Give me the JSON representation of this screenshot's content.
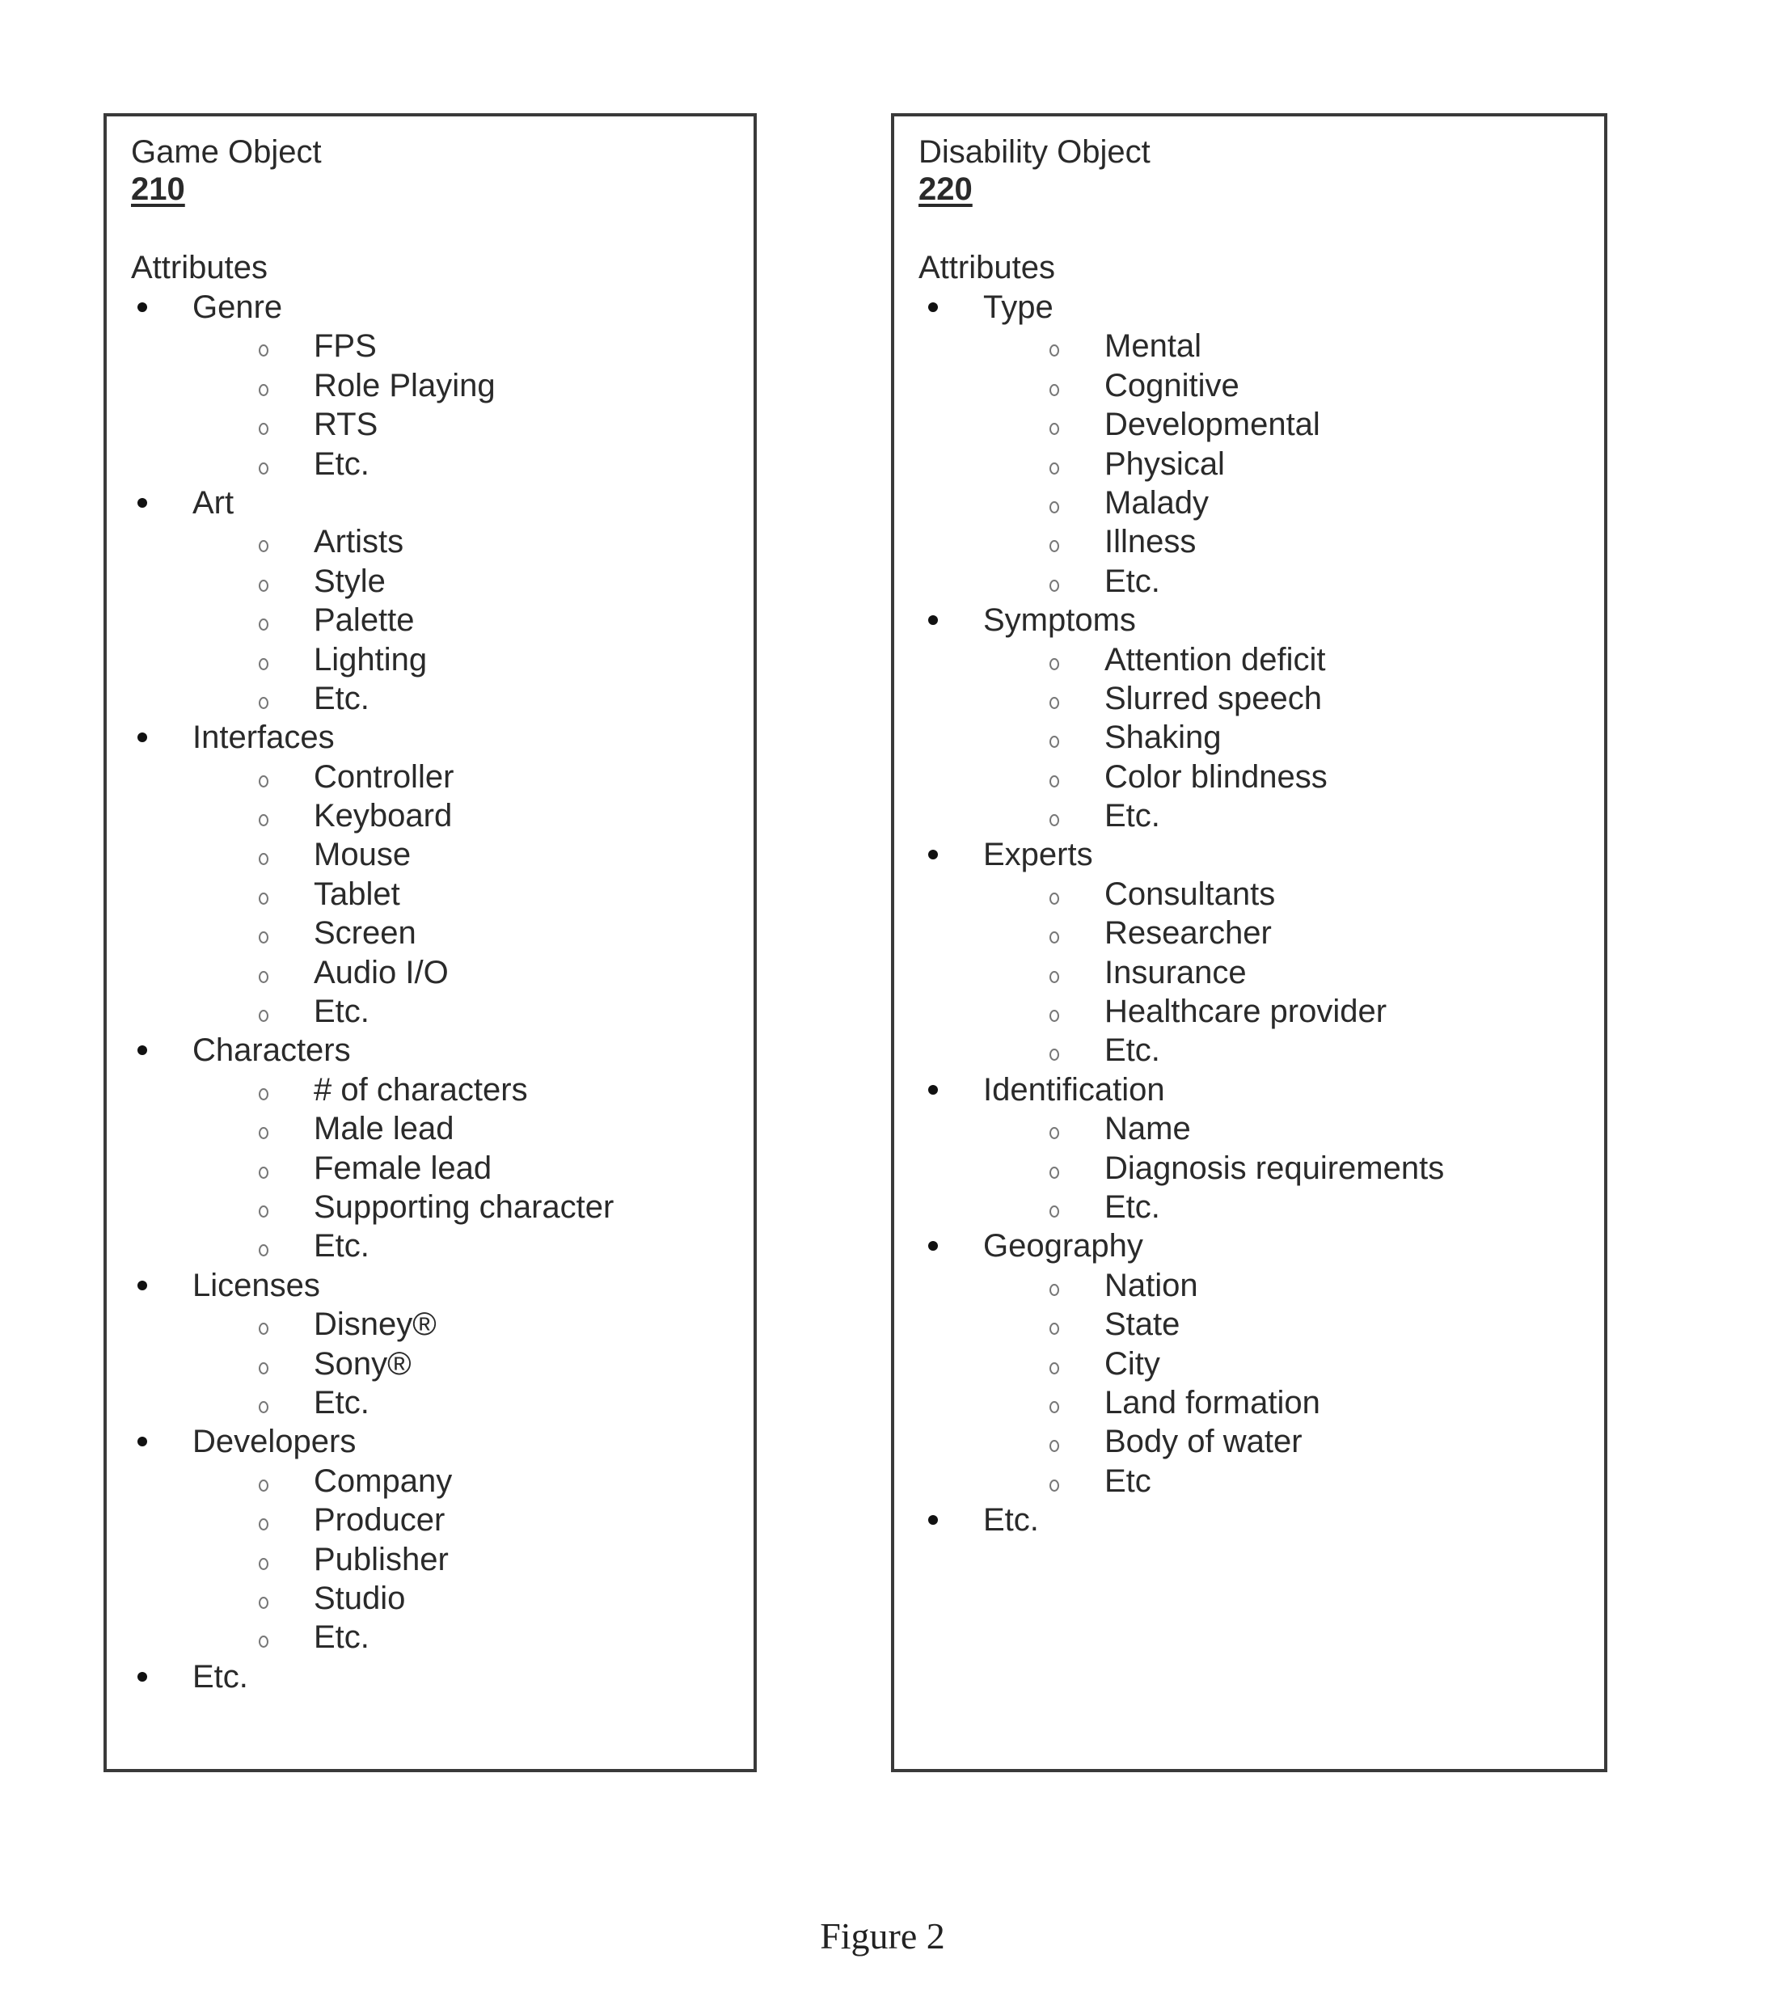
{
  "figure": {
    "caption": "Figure 2"
  },
  "game_object": {
    "title": "Game Object",
    "ref_number": "210",
    "attributes_label": "Attributes",
    "categories": [
      {
        "label": "Genre",
        "items": [
          "FPS",
          "Role Playing",
          "RTS",
          "Etc."
        ]
      },
      {
        "label": "Art",
        "items": [
          "Artists",
          "Style",
          "Palette",
          "Lighting",
          "Etc."
        ]
      },
      {
        "label": "Interfaces",
        "items": [
          "Controller",
          "Keyboard",
          "Mouse",
          "Tablet",
          "Screen",
          "Audio I/O",
          "Etc."
        ]
      },
      {
        "label": "Characters",
        "items": [
          "# of characters",
          "Male lead",
          "Female lead",
          "Supporting character",
          "Etc."
        ]
      },
      {
        "label": "Licenses",
        "items": [
          "Disney®",
          "Sony®",
          "Etc."
        ]
      },
      {
        "label": "Developers",
        "items": [
          "Company",
          "Producer",
          "Publisher",
          "Studio",
          "Etc."
        ]
      },
      {
        "label": "Etc.",
        "items": []
      }
    ]
  },
  "disability_object": {
    "title": "Disability Object",
    "ref_number": "220",
    "attributes_label": "Attributes",
    "categories": [
      {
        "label": "Type",
        "items": [
          "Mental",
          "Cognitive",
          "Developmental",
          "Physical",
          "Malady",
          "Illness",
          "Etc."
        ]
      },
      {
        "label": "Symptoms",
        "items": [
          "Attention deficit",
          "Slurred speech",
          "Shaking",
          "Color blindness",
          "Etc."
        ]
      },
      {
        "label": "Experts",
        "items": [
          "Consultants",
          "Researcher",
          "Insurance",
          "Healthcare provider",
          "Etc."
        ]
      },
      {
        "label": "Identification",
        "items": [
          "Name",
          "Diagnosis requirements",
          "Etc."
        ]
      },
      {
        "label": "Geography",
        "items": [
          "Nation",
          "State",
          "City",
          "Land formation",
          "Body of water",
          "Etc"
        ]
      },
      {
        "label": "Etc.",
        "items": []
      }
    ]
  }
}
